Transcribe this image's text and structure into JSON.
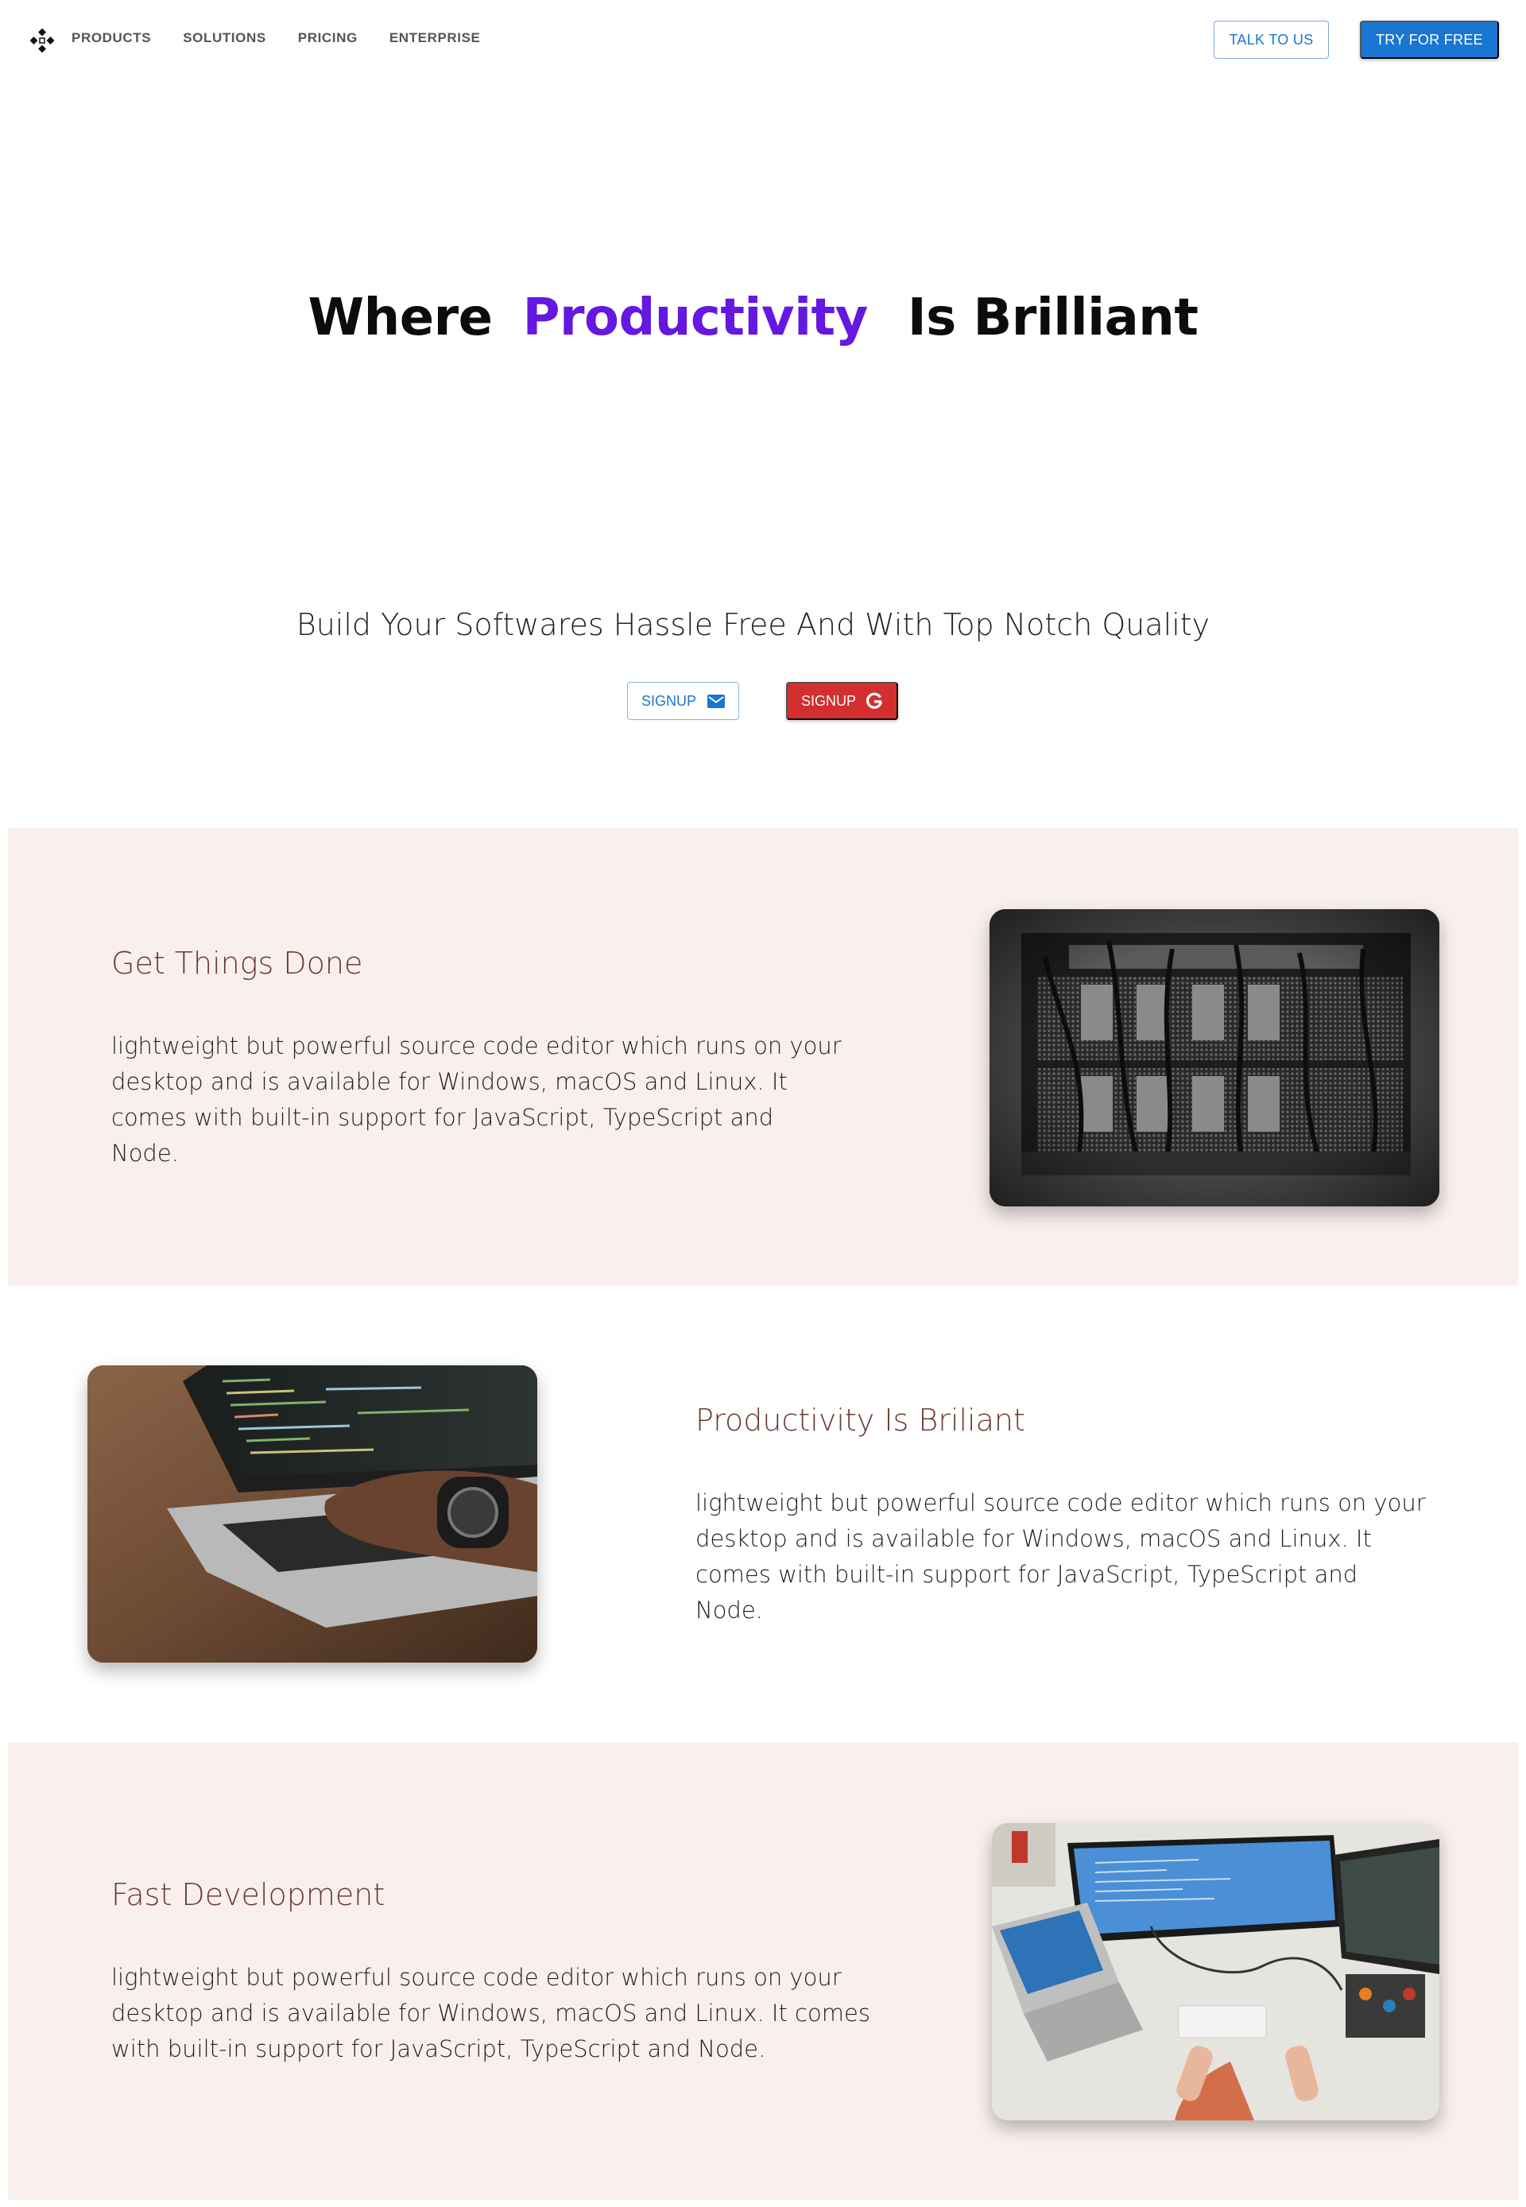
{
  "nav": {
    "links": [
      "PRODUCTS",
      "SOLUTIONS",
      "PRICING",
      "ENTERPRISE"
    ],
    "talk_label": "TALK TO US",
    "try_label": "TRY FOR FREE"
  },
  "hero": {
    "title_part1": "Where",
    "title_accent": "Productivity",
    "title_part2": "Is Brilliant",
    "subtitle": "Build Your Softwares Hassle Free And With Top Notch Quality",
    "signup_email_label": "SIGNUP",
    "signup_google_label": "SIGNUP"
  },
  "features": [
    {
      "title": "Get Things Done",
      "body": "lightweight but powerful source code editor which runs on your desktop and is available for Windows, macOS and Linux. It comes with built-in support for JavaScript, TypeScript and Node."
    },
    {
      "title": "Productivity Is Briliant",
      "body": "lightweight but powerful source code editor which runs on your desktop and is available for Windows, macOS and Linux. It comes with built-in support for JavaScript, TypeScript and Node."
    },
    {
      "title": "Fast Development",
      "body": "lightweight but powerful source code editor which runs on your desktop and is available for Windows, macOS and Linux. It comes with built-in support for JavaScript, TypeScript and Node."
    }
  ],
  "colors": {
    "accent": "#6418e0",
    "primary": "#1976d2",
    "google_red": "#d32f2f",
    "band_bg": "#f9f0ee",
    "feature_title": "#6b3a33"
  },
  "icons": [
    "logo-icon",
    "mail-icon",
    "google-icon"
  ]
}
